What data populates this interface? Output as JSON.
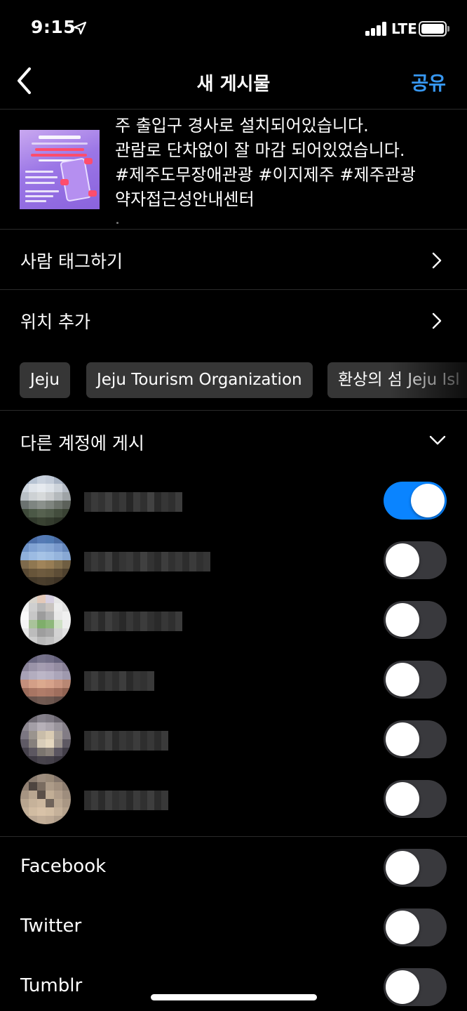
{
  "status_bar": {
    "time": "9:15",
    "network": "LTE"
  },
  "nav": {
    "title": "새 게시물",
    "share_label": "공유"
  },
  "caption": {
    "lines": [
      "주 출입구 경사로 설치되어있습니다.",
      "관람로 단차없이 잘 마감 되어있었습니다.",
      "#제주도무장애관광 #이지제주 #제주관광",
      "약자접근성안내센터"
    ]
  },
  "rows": {
    "tag_people": "사람 태그하기",
    "add_location": "위치 추가"
  },
  "location_suggestions": [
    "Jeju",
    "Jeju Tourism Organization",
    "환상의 섬 Jeju Isl"
  ],
  "post_to_other_accounts": {
    "heading": "다른 계정에 게시",
    "accounts": [
      {
        "enabled": true
      },
      {
        "enabled": false
      },
      {
        "enabled": false
      },
      {
        "enabled": false
      },
      {
        "enabled": false
      },
      {
        "enabled": false
      }
    ]
  },
  "social": [
    {
      "label": "Facebook",
      "enabled": false
    },
    {
      "label": "Twitter",
      "enabled": false
    },
    {
      "label": "Tumblr",
      "enabled": false
    }
  ],
  "colors": {
    "accent": "#3797f0",
    "toggle_on": "#0a84ff",
    "toggle_off": "#39393d",
    "chip_bg": "#363636"
  },
  "icons": {
    "back": "chevron-left-icon",
    "row_chevron": "chevron-right-icon",
    "section_chevron": "chevron-down-icon",
    "location_services": "location-arrow-icon"
  }
}
